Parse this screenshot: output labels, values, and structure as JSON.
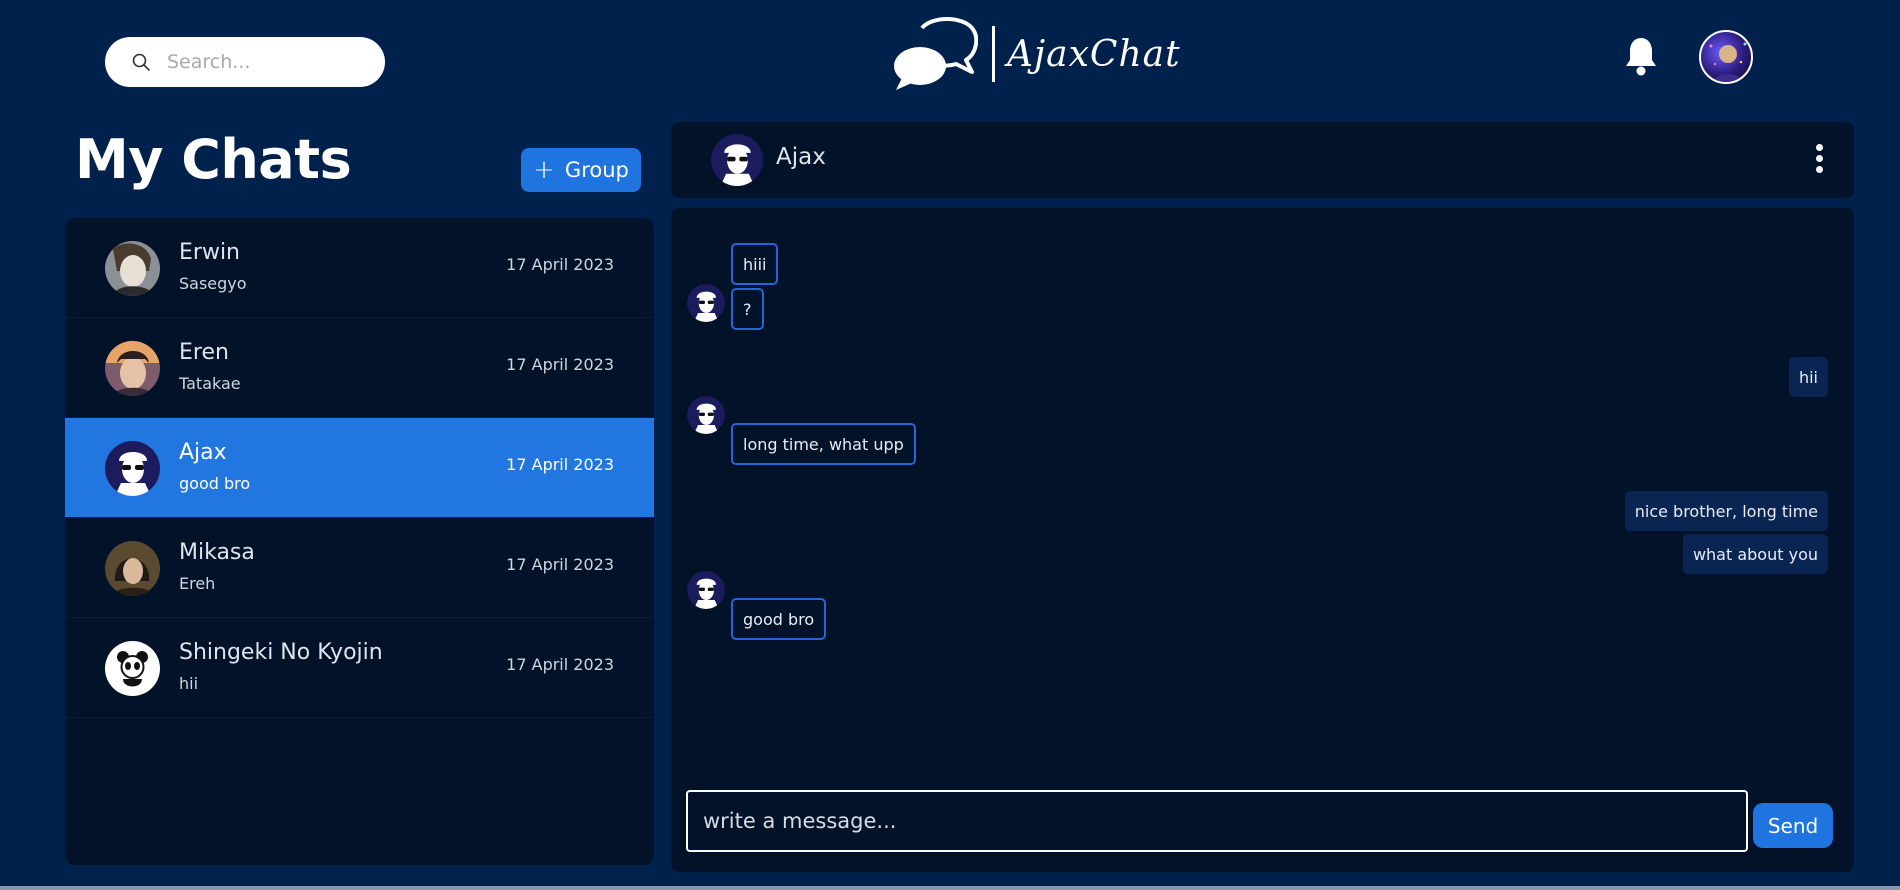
{
  "header": {
    "search_placeholder": "Search...",
    "app_name": "AjaxChat"
  },
  "sidebar": {
    "title": "My Chats",
    "group_button": "Group",
    "chats": [
      {
        "name": "Erwin",
        "last_message": "Sasegyo",
        "date": "17 April 2023",
        "active": false
      },
      {
        "name": "Eren",
        "last_message": "Tatakae",
        "date": "17 April 2023",
        "active": false
      },
      {
        "name": "Ajax",
        "last_message": "good bro",
        "date": "17 April 2023",
        "active": true
      },
      {
        "name": "Mikasa",
        "last_message": "Ereh",
        "date": "17 April 2023",
        "active": false
      },
      {
        "name": "Shingeki No Kyojin",
        "last_message": "hii",
        "date": "17 April 2023",
        "active": false
      }
    ]
  },
  "conversation": {
    "contact_name": "Ajax",
    "messages": [
      {
        "text": "hiii",
        "direction": "in"
      },
      {
        "text": "?",
        "direction": "in"
      },
      {
        "text": "hii",
        "direction": "out"
      },
      {
        "text": "long time, what upp",
        "direction": "in"
      },
      {
        "text": "nice brother, long time",
        "direction": "out"
      },
      {
        "text": "what about you",
        "direction": "out"
      },
      {
        "text": "good bro",
        "direction": "in"
      }
    ],
    "composer_placeholder": "write a message...",
    "send_button": "Send"
  },
  "colors": {
    "background": "#01214d",
    "panel": "#021229",
    "accent": "#1f74e0",
    "incoming_border": "#2766d8",
    "outgoing_bg": "#0a2552"
  }
}
